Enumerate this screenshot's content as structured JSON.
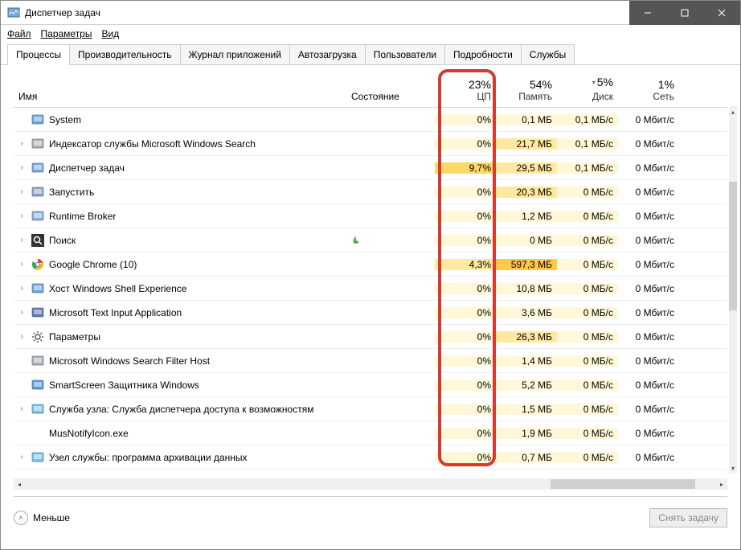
{
  "window": {
    "title": "Диспетчер задач"
  },
  "menu": {
    "file": "Файл",
    "options": "Параметры",
    "view": "Вид"
  },
  "tabs": [
    {
      "label": "Процессы",
      "active": true
    },
    {
      "label": "Производительность",
      "active": false
    },
    {
      "label": "Журнал приложений",
      "active": false
    },
    {
      "label": "Автозагрузка",
      "active": false
    },
    {
      "label": "Пользователи",
      "active": false
    },
    {
      "label": "Подробности",
      "active": false
    },
    {
      "label": "Службы",
      "active": false
    }
  ],
  "columns": {
    "name": "Имя",
    "state": "Состояние",
    "cpu": {
      "pct": "23%",
      "label": "ЦП"
    },
    "memory": {
      "pct": "54%",
      "label": "Память"
    },
    "disk": {
      "pct": "5%",
      "label": "Диск",
      "sort_arrow": "▾"
    },
    "network": {
      "pct": "1%",
      "label": "Сеть"
    }
  },
  "rows": [
    {
      "expand": false,
      "icon": "system-icon",
      "name": "System",
      "state": "",
      "cpu": "0%",
      "cpu_lvl": 0,
      "mem": "0,1 МБ",
      "mem_lvl": 0,
      "disk": "0,1 МБ/с",
      "net": "0 Мбит/с"
    },
    {
      "expand": true,
      "icon": "search-index-icon",
      "name": "Индексатор службы Microsoft Windows Search",
      "state": "",
      "cpu": "0%",
      "cpu_lvl": 0,
      "mem": "21,7 МБ",
      "mem_lvl": 1,
      "disk": "0,1 МБ/с",
      "net": "0 Мбит/с"
    },
    {
      "expand": true,
      "icon": "taskmgr-icon",
      "name": "Диспетчер задач",
      "state": "",
      "cpu": "9,7%",
      "cpu_lvl": 2,
      "mem": "29,5 МБ",
      "mem_lvl": 1,
      "disk": "0,1 МБ/с",
      "net": "0 Мбит/с"
    },
    {
      "expand": true,
      "icon": "run-icon",
      "name": "Запустить",
      "state": "",
      "cpu": "0%",
      "cpu_lvl": 0,
      "mem": "20,3 МБ",
      "mem_lvl": 1,
      "disk": "0 МБ/с",
      "net": "0 Мбит/с"
    },
    {
      "expand": true,
      "icon": "runtime-icon",
      "name": "Runtime Broker",
      "state": "",
      "cpu": "0%",
      "cpu_lvl": 0,
      "mem": "1,2 МБ",
      "mem_lvl": 0,
      "disk": "0 МБ/с",
      "net": "0 Мбит/с"
    },
    {
      "expand": true,
      "icon": "search-icon",
      "name": "Поиск",
      "state": "leaf",
      "cpu": "0%",
      "cpu_lvl": 0,
      "mem": "0 МБ",
      "mem_lvl": 0,
      "disk": "0 МБ/с",
      "net": "0 Мбит/с"
    },
    {
      "expand": true,
      "icon": "chrome-icon",
      "name": "Google Chrome (10)",
      "state": "",
      "cpu": "4,3%",
      "cpu_lvl": 1,
      "mem": "597,3 МБ",
      "mem_lvl": 2,
      "disk": "0 МБ/с",
      "net": "0 Мбит/с"
    },
    {
      "expand": true,
      "icon": "shell-icon",
      "name": "Хост Windows Shell Experience",
      "state": "",
      "cpu": "0%",
      "cpu_lvl": 0,
      "mem": "10,8 МБ",
      "mem_lvl": 0,
      "disk": "0 МБ/с",
      "net": "0 Мбит/с"
    },
    {
      "expand": true,
      "icon": "textinput-icon",
      "name": "Microsoft Text Input Application",
      "state": "",
      "cpu": "0%",
      "cpu_lvl": 0,
      "mem": "3,6 МБ",
      "mem_lvl": 0,
      "disk": "0 МБ/с",
      "net": "0 Мбит/с"
    },
    {
      "expand": true,
      "icon": "settings-icon",
      "name": "Параметры",
      "state": "",
      "cpu": "0%",
      "cpu_lvl": 0,
      "mem": "26,3 МБ",
      "mem_lvl": 1,
      "disk": "0 МБ/с",
      "net": "0 Мбит/с"
    },
    {
      "expand": false,
      "icon": "search-filter-icon",
      "name": "Microsoft Windows Search Filter Host",
      "state": "",
      "cpu": "0%",
      "cpu_lvl": 0,
      "mem": "1,4 МБ",
      "mem_lvl": 0,
      "disk": "0 МБ/с",
      "net": "0 Мбит/с"
    },
    {
      "expand": false,
      "icon": "smartscreen-icon",
      "name": "SmartScreen Защитника Windows",
      "state": "",
      "cpu": "0%",
      "cpu_lvl": 0,
      "mem": "5,2 МБ",
      "mem_lvl": 0,
      "disk": "0 МБ/с",
      "net": "0 Мбит/с"
    },
    {
      "expand": true,
      "icon": "service-icon",
      "name": "Служба узла: Служба диспетчера доступа к возможностям",
      "state": "",
      "cpu": "0%",
      "cpu_lvl": 0,
      "mem": "1,5 МБ",
      "mem_lvl": 0,
      "disk": "0 МБ/с",
      "net": "0 Мбит/с"
    },
    {
      "expand": false,
      "icon": "blank-icon",
      "name": "MusNotifyIcon.exe",
      "state": "",
      "cpu": "0%",
      "cpu_lvl": 0,
      "mem": "1,9 МБ",
      "mem_lvl": 0,
      "disk": "0 МБ/с",
      "net": "0 Мбит/с"
    },
    {
      "expand": true,
      "icon": "service-icon",
      "name": "Узел службы: программа архивации данных",
      "state": "",
      "cpu": "0%",
      "cpu_lvl": 0,
      "mem": "0,7 МБ",
      "mem_lvl": 0,
      "disk": "0 МБ/с",
      "net": "0 Мбит/с"
    }
  ],
  "footer": {
    "less": "Меньше",
    "end_task": "Снять задачу"
  },
  "icons": {
    "system-icon": "#6aa2dc",
    "search-index-icon": "#b0b0b0",
    "taskmgr-icon": "#7aa8d8",
    "run-icon": "#8aa5c0",
    "runtime-icon": "#8aafd6",
    "search-icon": "#333333",
    "chrome-icon": "chrome",
    "shell-icon": "#6aa2dc",
    "textinput-icon": "#5a73b0",
    "settings-icon": "#6b6b6b",
    "search-filter-icon": "#b0b0b0",
    "smartscreen-icon": "#5a98d8",
    "service-icon": "#7cc0e2",
    "blank-icon": "#ffffff"
  }
}
